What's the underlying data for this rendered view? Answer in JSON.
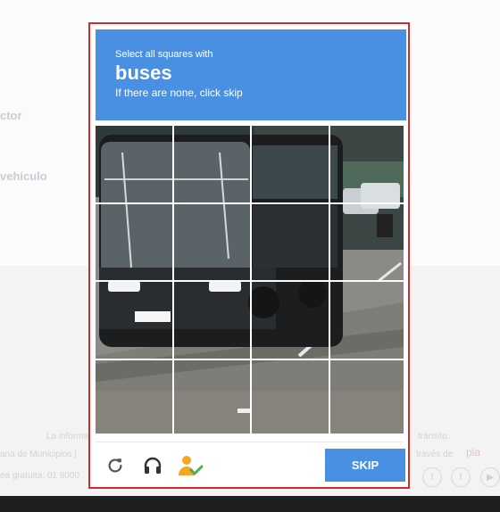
{
  "background": {
    "label_1": "ctor",
    "label_2": "vehículo",
    "footer_line_1": "La informa",
    "footer_line_1b": "tránsito.",
    "footer_line_2": "ana de Municipios |",
    "footer_line_2b": "través de",
    "footer_brand": "pla",
    "footer_line_3": "ea gratuita: 01 8000"
  },
  "captcha": {
    "instruction": "Select all squares with",
    "target": "buses",
    "hint": "If there are none, click skip",
    "skip_label": "SKIP",
    "reload_icon": "reload-icon",
    "audio_icon": "headphones-icon",
    "verify_icon": "person-check-icon",
    "colors": {
      "header": "#4a90e2",
      "border": "#d32a2a",
      "skip_button": "#4a90e2",
      "person_icon": "#f5a623",
      "check_icon": "#4caf50"
    },
    "grid": {
      "rows": 4,
      "cols": 4
    }
  }
}
